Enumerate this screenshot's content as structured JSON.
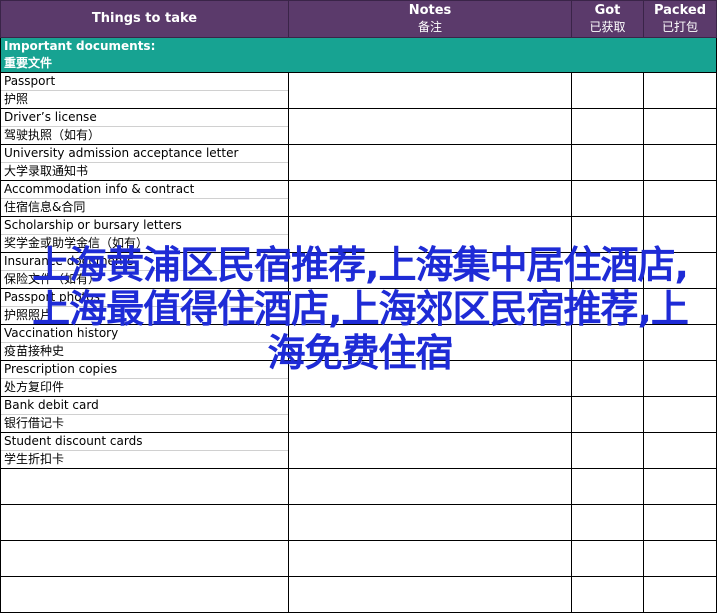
{
  "table": {
    "headers": {
      "things": "Things to take",
      "notes_en": "Notes",
      "notes_zh": "备注",
      "got_en": "Got",
      "got_zh": "已获取",
      "packed_en": "Packed",
      "packed_zh": "已打包"
    },
    "section": {
      "title_en": "Important documents:",
      "title_zh": "重要文件"
    },
    "items": [
      {
        "en": "Passport",
        "zh": "护照"
      },
      {
        "en": "Driver’s license",
        "zh": "驾驶执照（如有）"
      },
      {
        "en": "University admission acceptance letter",
        "zh": "大学录取通知书"
      },
      {
        "en": "Accommodation info & contract",
        "zh": "住宿信息&合同"
      },
      {
        "en": "Scholarship or bursary letters",
        "zh": "奖学金或助学金信（如有）"
      },
      {
        "en": "Insurance documents",
        "zh": "保险文件（如有）"
      },
      {
        "en": "Passport photos",
        "zh": "护照照片"
      },
      {
        "en": "Vaccination history",
        "zh": "疫苗接种史"
      },
      {
        "en": "Prescription copies",
        "zh": "处方复印件"
      },
      {
        "en": "Bank debit card",
        "zh": "银行借记卡"
      },
      {
        "en": "Student discount cards",
        "zh": "学生折扣卡"
      }
    ],
    "blank_rows": 4
  },
  "overlay": {
    "text": "上海黄浦区民宿推荐,上海集中居住酒店,上海最值得住酒店,上海郊区民宿推荐,上海免费住宿"
  }
}
